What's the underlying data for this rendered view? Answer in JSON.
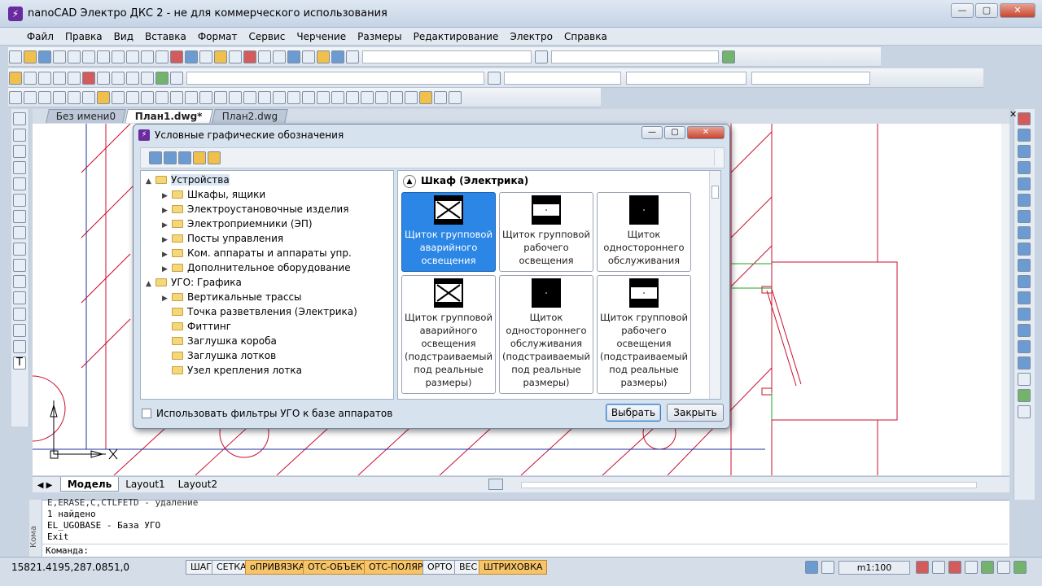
{
  "app": {
    "title": "nanoCAD Электро ДКС 2 - не для коммерческого использования",
    "icon": "app-logo-icon"
  },
  "menu": [
    "Файл",
    "Правка",
    "Вид",
    "Вставка",
    "Формат",
    "Сервис",
    "Черчение",
    "Размеры",
    "Редактирование",
    "Электро",
    "Справка"
  ],
  "doc_tabs": [
    "Без имени0",
    "План1.dwg*",
    "План2.dwg"
  ],
  "layout_tabs": [
    "Модель",
    "Layout1",
    "Layout2"
  ],
  "command": {
    "lines": [
      "E,ERASE,C,CTLFETD - удаление",
      "1 найдено",
      "EL_UGOBASE - База УГО",
      "Exit"
    ],
    "prompt": "Команда:",
    "side_label": "Кома"
  },
  "status": {
    "coords": "15821.4195,287.0851,0",
    "buttons": [
      {
        "label": "ШАГ",
        "on": false
      },
      {
        "label": "СЕТКА",
        "on": false
      },
      {
        "label": "оПРИВЯЗКА",
        "on": true
      },
      {
        "label": "ОТС-ОБЪЕКТ",
        "on": true
      },
      {
        "label": "ОТС-ПОЛЯР",
        "on": true
      },
      {
        "label": "ОРТО",
        "on": false
      },
      {
        "label": "ВЕС",
        "on": false
      },
      {
        "label": "ШТРИХОВКА",
        "on": true
      }
    ],
    "scale": "m1:100"
  },
  "dialog": {
    "title": "Условные графические обозначения",
    "tree": [
      {
        "label": "Устройства",
        "level": 0,
        "arrow": "▲",
        "selected": true
      },
      {
        "label": "Шкафы, ящики",
        "level": 1,
        "arrow": "▶"
      },
      {
        "label": "Электроустановочные изделия",
        "level": 1,
        "arrow": "▶"
      },
      {
        "label": "Электроприемники (ЭП)",
        "level": 1,
        "arrow": "▶"
      },
      {
        "label": "Посты управления",
        "level": 1,
        "arrow": "▶"
      },
      {
        "label": "Ком. аппараты и аппараты упр.",
        "level": 1,
        "arrow": "▶"
      },
      {
        "label": "Дополнительное оборудование",
        "level": 1,
        "arrow": "▶"
      },
      {
        "label": "УГО: Графика",
        "level": 0,
        "arrow": "▲"
      },
      {
        "label": "Вертикальные трассы",
        "level": 1,
        "arrow": "▶"
      },
      {
        "label": "Точка разветвления (Электрика)",
        "level": 1,
        "arrow": ""
      },
      {
        "label": "Фиттинг",
        "level": 1,
        "arrow": ""
      },
      {
        "label": "Заглушка короба",
        "level": 1,
        "arrow": ""
      },
      {
        "label": "Заглушка лотков",
        "level": 1,
        "arrow": ""
      },
      {
        "label": "Узел крепления лотка",
        "level": 1,
        "arrow": ""
      }
    ],
    "section_title": "Шкаф (Электрика)",
    "cards": [
      {
        "lines": [
          "Щиток групповой",
          "аварийного",
          "освещения"
        ],
        "symbol": "cross",
        "selected": true
      },
      {
        "lines": [
          "Щиток групповой",
          "рабочего",
          "освещения"
        ],
        "symbol": "band-white"
      },
      {
        "lines": [
          "Щиток",
          "одностороннего",
          "обслуживания"
        ],
        "symbol": "solid"
      },
      {
        "lines": [
          "Щиток групповой",
          "аварийного",
          "освещения",
          "(подстраиваемый",
          "под реальные",
          "размеры)"
        ],
        "symbol": "cross"
      },
      {
        "lines": [
          "Щиток",
          "одностороннего",
          "обслуживания",
          "(подстраиваемый",
          "под реальные",
          "размеры)"
        ],
        "symbol": "solid"
      },
      {
        "lines": [
          "Щиток групповой",
          "рабочего",
          "освещения",
          "(подстраиваемый",
          "под реальные",
          "размеры)"
        ],
        "symbol": "band-white"
      }
    ],
    "checkbox_label": "Использовать фильтры УГО к базе аппаратов",
    "select_button": "Выбрать",
    "close_button": "Закрыть"
  },
  "colors": {
    "selection": "#2b86e6",
    "drawing_red": "#c8102e",
    "drawing_green": "#1fa31f",
    "drawing_blue": "#1b2fa0"
  }
}
